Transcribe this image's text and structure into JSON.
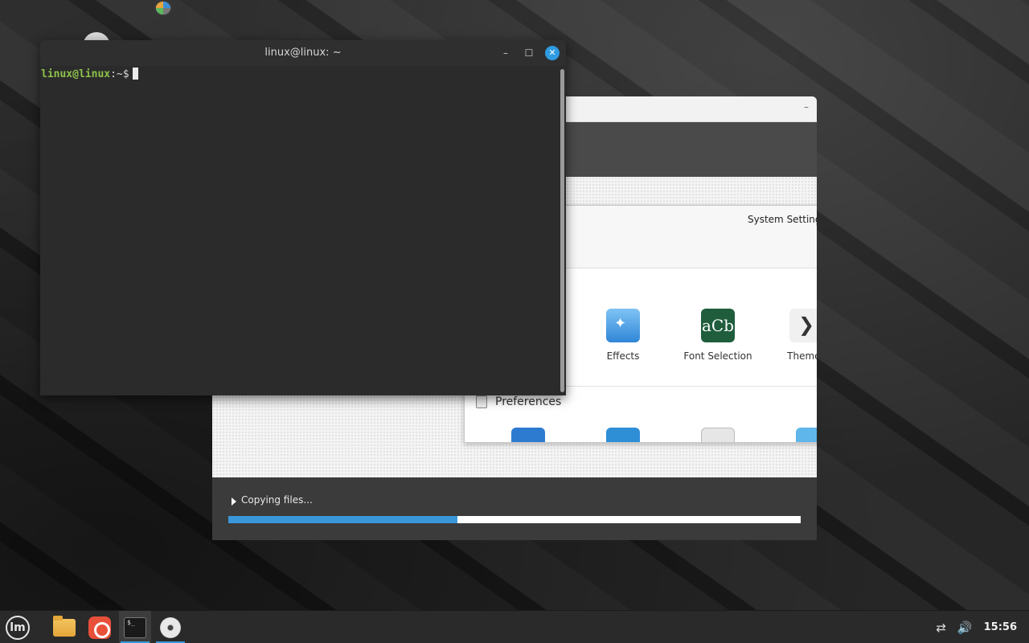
{
  "terminal": {
    "title": "linux@linux: ~",
    "minimize_label": "–",
    "maximize_label": "☐",
    "close_label": "✕",
    "prompt_user": "linux@linux",
    "prompt_path": ":~$"
  },
  "installer": {
    "minimize_label": "–",
    "slide": {
      "title": "System Settings",
      "tiles": [
        {
          "label": "Effects",
          "icon": "effects-icon"
        },
        {
          "label": "Font Selection",
          "icon": "font-selection-icon",
          "glyph": "aCb"
        },
        {
          "label": "Themes",
          "icon": "themes-icon",
          "glyph": "❯"
        }
      ],
      "section_label": "Preferences"
    },
    "progress": {
      "status_text": "Copying files...",
      "fraction": 0.4
    }
  },
  "taskbar": {
    "menu_glyph": "lm",
    "apps": [
      {
        "name": "files",
        "icon": "folder-icon",
        "active": false
      },
      {
        "name": "firefox",
        "icon": "firefox-icon",
        "active": false
      },
      {
        "name": "terminal",
        "icon": "terminal-icon",
        "active": true,
        "glyph": "$_"
      },
      {
        "name": "installer",
        "icon": "disc-icon",
        "active": true
      }
    ],
    "tray": {
      "network_glyph": "⇄",
      "volume_glyph": "🔊",
      "clock": "15:56"
    }
  },
  "colors": {
    "accent": "#3a97d9",
    "prompt_user": "#8ec24a",
    "terminal_bg": "#2b2b2b",
    "taskbar_bg": "#2a2a2a"
  }
}
